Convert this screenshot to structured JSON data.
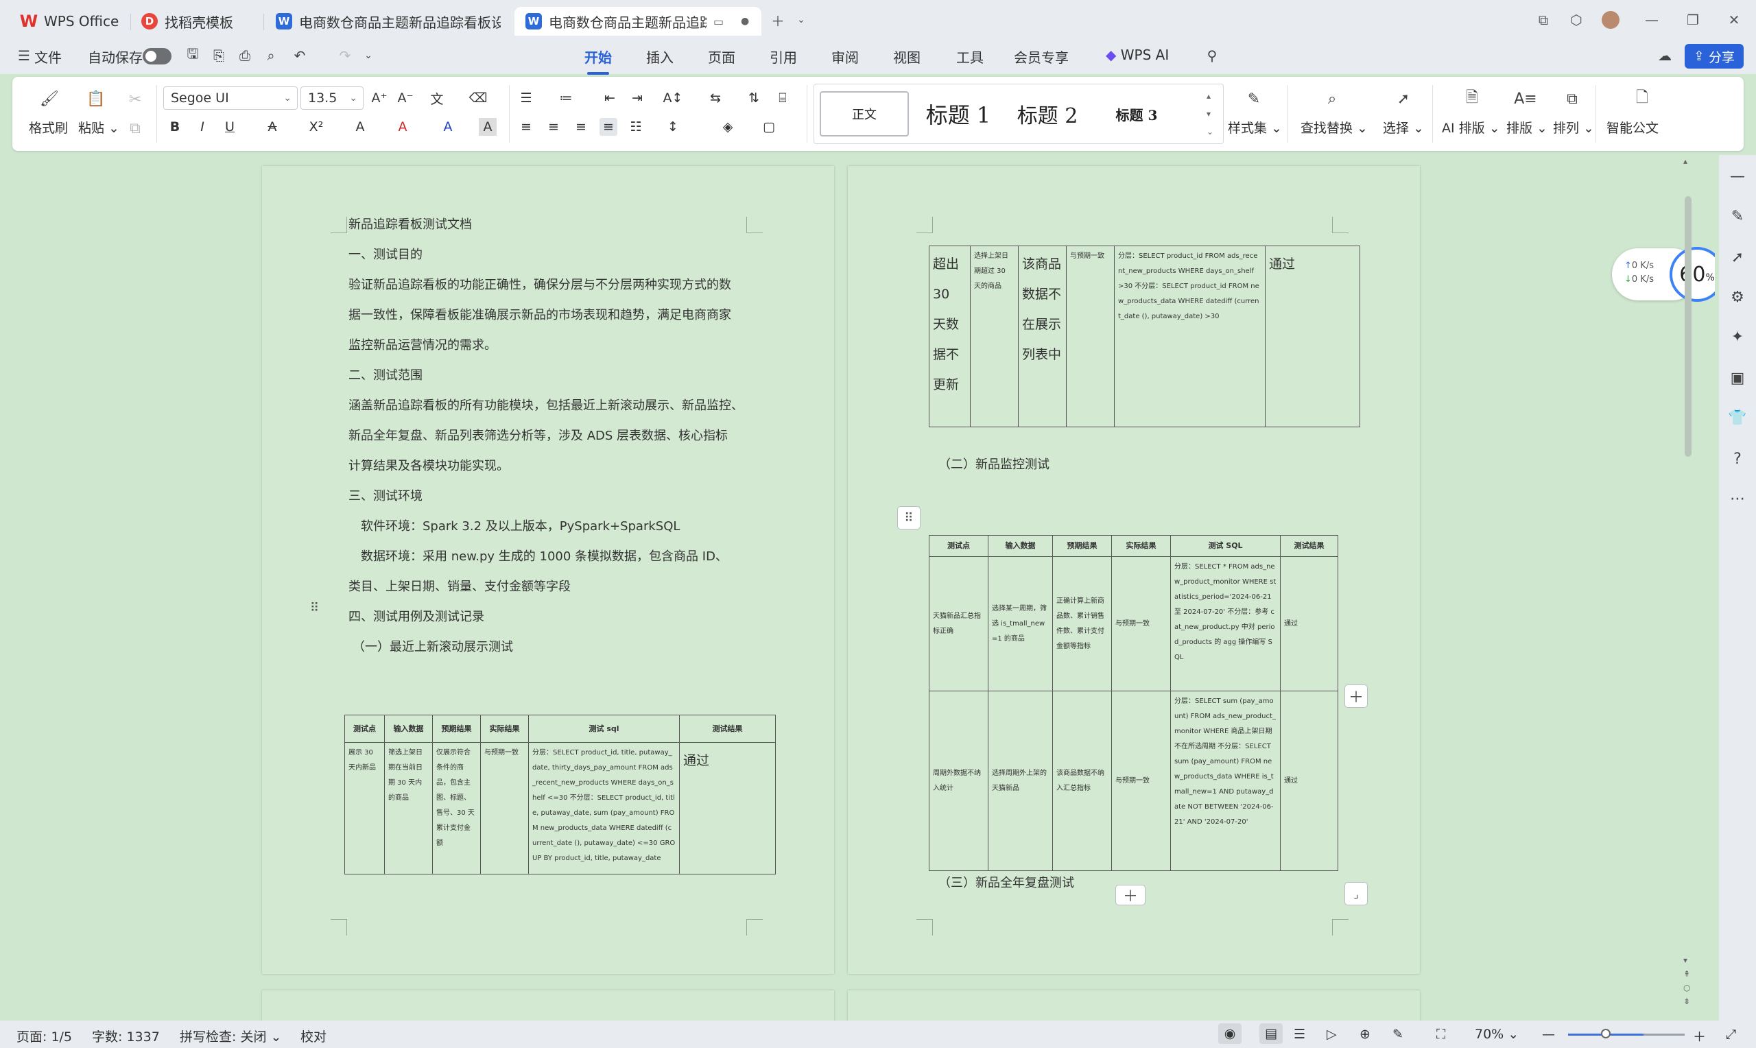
{
  "titlebar": {
    "tabs": [
      {
        "label": "WPS Office",
        "icon": "wps-logo-icon"
      },
      {
        "label": "找稻壳模板",
        "icon": "docer-template-icon"
      },
      {
        "label": "电商数仓商品主题新品追踪看板设计",
        "icon": "wps-writer-icon"
      },
      {
        "label": "电商数仓商品主题新品追踪看板",
        "icon": "wps-writer-icon"
      }
    ]
  },
  "menubar": {
    "file_label": "文件",
    "autosave_label": "自动保存",
    "tabs": [
      "开始",
      "插入",
      "页面",
      "引用",
      "审阅",
      "视图",
      "工具",
      "会员专享",
      "WPS AI"
    ],
    "share_label": "分享"
  },
  "ribbon": {
    "format_painter": "格式刷",
    "paste": "粘贴",
    "font_name": "Segoe UI",
    "font_size": "13.5",
    "styles": [
      "正文",
      "标题 1",
      "标题 2",
      "标题 3"
    ],
    "style_set": "样式集",
    "find_replace": "查找替换",
    "select": "选择",
    "ai_layout": "AI 排版",
    "layout": "排版",
    "arrange": "排列",
    "smart_doc": "智能公文"
  },
  "page1": {
    "lines": [
      "新品追踪看板测试文档",
      "一、测试目的",
      "验证新品追踪看板的功能正确性，确保分层与不分层两种实现方式的数",
      "据一致性，保障看板能准确展示新品的市场表现和趋势，满足电商商家",
      "监控新品运营情况的需求。",
      "二、测试范围",
      "涵盖新品追踪看板的所有功能模块，包括最近上新滚动展示、新品监控、",
      "新品全年复盘、新品列表筛选分析等，涉及 ADS 层表数据、核心指标",
      "计算结果及各模块功能实现。",
      "三、测试环境",
      "软件环境：Spark 3.2  及以上版本，PySpark+SparkSQL",
      "数据环境：采用  new.py  生成的  1000  条模拟数据，包含商品  ID、",
      "类目、上架日期、销量、支付金额等字段",
      "四、测试用例及测试记录",
      "（一）最近上新滚动展示测试"
    ],
    "table": {
      "headers": [
        "测试点",
        "输入数据",
        "预期结果",
        "实际结果",
        "测试 sql",
        "测试结果"
      ],
      "row": {
        "point": "展示 30 天内新品",
        "input": "筛选上架日期在当前日期 30 天内的商品",
        "expected": "仅展示符合条件的商品，包含主图、标题、售号、30 天累计支付金额",
        "actual": "与预期一致",
        "sql": "分层：SELECT product_id, title, putaway_date, thirty_days_pay_amount FROM ads_recent_new_products WHERE days_on_shelf <=30  不分层：SELECT product_id, title, putaway_date, sum (pay_amount) FROM new_products_data WHERE datediff (current_date (), putaway_date) <=30 GROUP BY product_id, title, putaway_date",
        "result": "通过"
      }
    }
  },
  "page2": {
    "table_cont": {
      "point": "超出 30 天数据不更新",
      "input": "选择上架日期超过 30 天的商品",
      "expected": "该商品数据不在展示列表中",
      "actual": "与预期一致",
      "sql": "分层：SELECT product_id FROM ads_recent_new_products WHERE days_on_shelf >30  不分层：SELECT product_id FROM new_products_data WHERE datediff (current_date (), putaway_date) >30",
      "result": "通过"
    },
    "section2_title": "（二）新品监控测试",
    "table2": {
      "headers": [
        "测试点",
        "输入数据",
        "预期结果",
        "实际结果",
        "测试 SQL",
        "测试结果"
      ],
      "rows": [
        {
          "point": "天猫新品汇总指标正确",
          "input": "选择某一周期，筛选 is_tmall_new=1 的商品",
          "expected": "正确计算上新商品数、累计销售件数、累计支付金额等指标",
          "actual": "与预期一致",
          "sql": "分层：SELECT * FROM ads_new_product_monitor WHERE statistics_period='2024-06-21 至 2024-07-20'  不分层：参考 cat_new_product.py 中对 period_products 的 agg 操作编写 SQL",
          "result": "通过"
        },
        {
          "point": "周期外数据不纳入统计",
          "input": "选择周期外上架的天猫新品",
          "expected": "该商品数据不纳入汇总指标",
          "actual": "与预期一致",
          "sql": "分层：SELECT sum (pay_amount) FROM ads_new_product_monitor WHERE 商品上架日期不在所选周期  不分层：SELECT sum (pay_amount) FROM new_products_data WHERE is_tmall_new=1 AND putaway_date NOT BETWEEN '2024-06-21' AND '2024-07-20'",
          "result": "通过"
        }
      ]
    },
    "section3_title": "（三）新品全年复盘测试"
  },
  "speed_widget": {
    "up": "0  K/s",
    "down": "0  K/s",
    "percent": "60",
    "percent_unit": "%"
  },
  "statusbar": {
    "page": "页面: 1/5",
    "words": "字数: 1337",
    "spell": "拼写检查: 关闭",
    "proof": "校对",
    "zoom": "70%"
  }
}
